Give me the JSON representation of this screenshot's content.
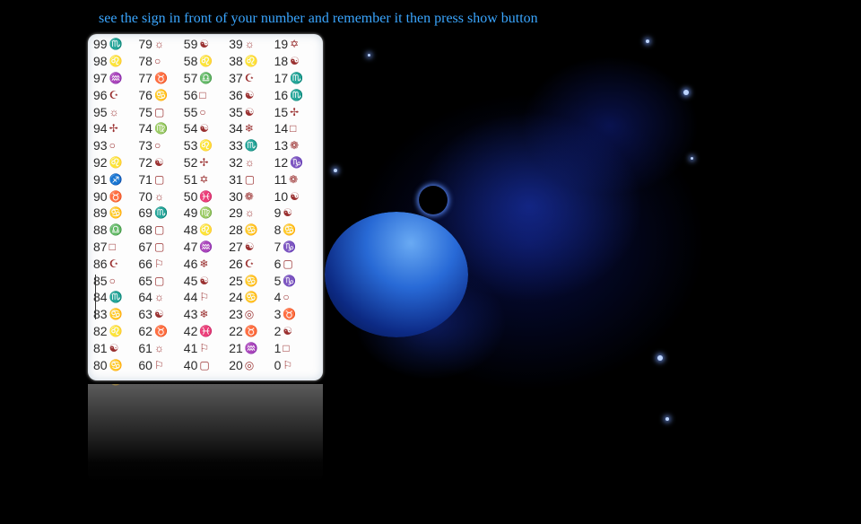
{
  "instruction": "see the sign in front of your number and remember it then press show button",
  "colors": {
    "accent": "#3aa6ff",
    "card": "#fdfdfd",
    "symbol": "#9a3030"
  },
  "rows": [
    [
      {
        "n": "99",
        "s": "♏"
      },
      {
        "n": "79",
        "s": "☼"
      },
      {
        "n": "59",
        "s": "☯"
      },
      {
        "n": "39",
        "s": "☼"
      },
      {
        "n": "19",
        "s": "✡"
      }
    ],
    [
      {
        "n": "98",
        "s": "♌"
      },
      {
        "n": "78",
        "s": "○"
      },
      {
        "n": "58",
        "s": "♌"
      },
      {
        "n": "38",
        "s": "♌"
      },
      {
        "n": "18",
        "s": "☯"
      }
    ],
    [
      {
        "n": "97",
        "s": "♒"
      },
      {
        "n": "77",
        "s": "♉"
      },
      {
        "n": "57",
        "s": "♎"
      },
      {
        "n": "37",
        "s": "☪"
      },
      {
        "n": "17",
        "s": "♏"
      }
    ],
    [
      {
        "n": "96",
        "s": "☪"
      },
      {
        "n": "76",
        "s": "♋"
      },
      {
        "n": "56",
        "s": "□"
      },
      {
        "n": "36",
        "s": "☯"
      },
      {
        "n": "16",
        "s": "♏"
      }
    ],
    [
      {
        "n": "95",
        "s": "☼"
      },
      {
        "n": "75",
        "s": "▢"
      },
      {
        "n": "55",
        "s": "○"
      },
      {
        "n": "35",
        "s": "☯"
      },
      {
        "n": "15",
        "s": "✢"
      }
    ],
    [
      {
        "n": "94",
        "s": "✢"
      },
      {
        "n": "74",
        "s": "♍"
      },
      {
        "n": "54",
        "s": "☯"
      },
      {
        "n": "34",
        "s": "❄"
      },
      {
        "n": "14",
        "s": "□"
      }
    ],
    [
      {
        "n": "93",
        "s": "○"
      },
      {
        "n": "73",
        "s": "○"
      },
      {
        "n": "53",
        "s": "♌"
      },
      {
        "n": "33",
        "s": "♏"
      },
      {
        "n": "13",
        "s": "❁"
      }
    ],
    [
      {
        "n": "92",
        "s": "♌"
      },
      {
        "n": "72",
        "s": "☯"
      },
      {
        "n": "52",
        "s": "✢"
      },
      {
        "n": "32",
        "s": "☼"
      },
      {
        "n": "12",
        "s": "♑"
      }
    ],
    [
      {
        "n": "91",
        "s": "♐"
      },
      {
        "n": "71",
        "s": "▢"
      },
      {
        "n": "51",
        "s": "✡"
      },
      {
        "n": "31",
        "s": "▢"
      },
      {
        "n": "11",
        "s": "❁"
      }
    ],
    [
      {
        "n": "90",
        "s": "♉"
      },
      {
        "n": "70",
        "s": "☼"
      },
      {
        "n": "50",
        "s": "♓"
      },
      {
        "n": "30",
        "s": "❁"
      },
      {
        "n": "10",
        "s": "☯"
      }
    ],
    [
      {
        "n": "89",
        "s": "♋"
      },
      {
        "n": "69",
        "s": "♏"
      },
      {
        "n": "49",
        "s": "♍"
      },
      {
        "n": "29",
        "s": "☼"
      },
      {
        "n": "9",
        "s": "☯"
      }
    ],
    [
      {
        "n": "88",
        "s": "♎"
      },
      {
        "n": "68",
        "s": "▢"
      },
      {
        "n": "48",
        "s": "♌"
      },
      {
        "n": "28",
        "s": "♋"
      },
      {
        "n": "8",
        "s": "♋"
      }
    ],
    [
      {
        "n": "87",
        "s": "□"
      },
      {
        "n": "67",
        "s": "▢"
      },
      {
        "n": "47",
        "s": "♒"
      },
      {
        "n": "27",
        "s": "☯"
      },
      {
        "n": "7",
        "s": "♑"
      }
    ],
    [
      {
        "n": "86",
        "s": "☪"
      },
      {
        "n": "66",
        "s": "⚐"
      },
      {
        "n": "46",
        "s": "❄"
      },
      {
        "n": "26",
        "s": "☪"
      },
      {
        "n": "6",
        "s": "▢"
      }
    ],
    [
      {
        "n": "85",
        "s": "○"
      },
      {
        "n": "65",
        "s": "▢"
      },
      {
        "n": "45",
        "s": "☯"
      },
      {
        "n": "25",
        "s": "♋"
      },
      {
        "n": "5",
        "s": "♑"
      }
    ],
    [
      {
        "n": "84",
        "s": "♏"
      },
      {
        "n": "64",
        "s": "☼"
      },
      {
        "n": "44",
        "s": "⚐"
      },
      {
        "n": "24",
        "s": "♋"
      },
      {
        "n": "4",
        "s": "○"
      }
    ],
    [
      {
        "n": "83",
        "s": "♋"
      },
      {
        "n": "63",
        "s": "☯"
      },
      {
        "n": "43",
        "s": "❄"
      },
      {
        "n": "23",
        "s": "◎"
      },
      {
        "n": "3",
        "s": "♉"
      }
    ],
    [
      {
        "n": "82",
        "s": "♌"
      },
      {
        "n": "62",
        "s": "♉"
      },
      {
        "n": "42",
        "s": "♓"
      },
      {
        "n": "22",
        "s": "♉"
      },
      {
        "n": "2",
        "s": "☯"
      }
    ],
    [
      {
        "n": "81",
        "s": "☯"
      },
      {
        "n": "61",
        "s": "☼"
      },
      {
        "n": "41",
        "s": "⚐"
      },
      {
        "n": "21",
        "s": "♒"
      },
      {
        "n": "1",
        "s": "□"
      }
    ],
    [
      {
        "n": "80",
        "s": "♋"
      },
      {
        "n": "60",
        "s": "⚐"
      },
      {
        "n": "40",
        "s": "▢"
      },
      {
        "n": "20",
        "s": "◎"
      },
      {
        "n": "0",
        "s": "⚐"
      }
    ]
  ]
}
